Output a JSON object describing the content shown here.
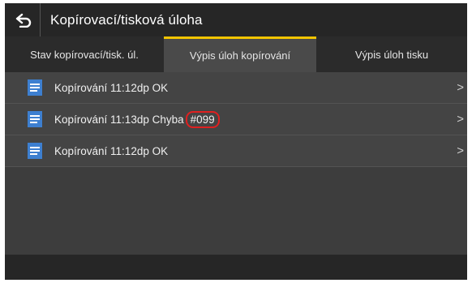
{
  "header": {
    "title": "Kopírovací/tisková úloha"
  },
  "tabs": [
    {
      "label": "Stav kopírovací/tisk. úl."
    },
    {
      "label": "Výpis úloh kopírování"
    },
    {
      "label": "Výpis úloh tisku"
    }
  ],
  "jobs": [
    {
      "text": "Kopírování 11:12dp OK",
      "error_code": ""
    },
    {
      "text": "Kopírování 11:13dp Chyba",
      "error_code": "#099"
    },
    {
      "text": "Kopírování 11:12dp OK",
      "error_code": ""
    }
  ],
  "colors": {
    "accent": "#f2c500",
    "highlight_circle": "#e02020",
    "icon_blue": "#3d7fd0"
  },
  "icons": {
    "back": "back-arrow-icon",
    "job": "document-icon",
    "row_arrow": "chevron-right-icon"
  }
}
